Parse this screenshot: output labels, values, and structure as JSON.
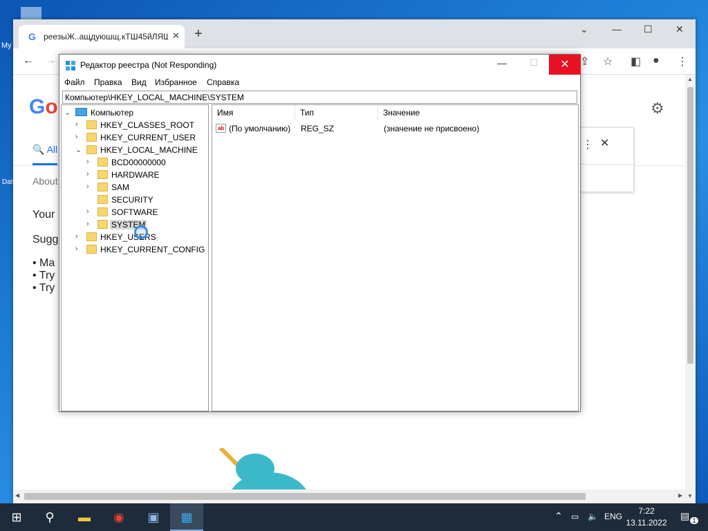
{
  "desktop": {
    "icon1_label": "My",
    "icon2_label": "Dat"
  },
  "chrome": {
    "tab_title": "реезыЖ..ащдуюшщ.кТШ45йЛЯШ",
    "tab_favicon": "G",
    "close_tab": "✕",
    "new_tab": "+",
    "minimize": "⌄",
    "restore": "—",
    "maximize": "☐",
    "close": "✕",
    "page": {
      "logo": "Go",
      "tab_all": "All",
      "about": "About",
      "line1": "Your",
      "line2": "Sugg",
      "bullets": [
        "Ma",
        "Try",
        "Try"
      ]
    }
  },
  "regedit": {
    "title": "Редактор реестра (Not Responding)",
    "close_label": "✕",
    "minimize_label": "—",
    "maximize_label": "☐",
    "menu": {
      "file": "Файл",
      "edit": "Правка",
      "view": "Вид",
      "favorites": "Избранное",
      "help": "Справка"
    },
    "address": "Компьютер\\HKEY_LOCAL_MACHINE\\SYSTEM",
    "tree": {
      "root": "Компьютер",
      "classes_root": "HKEY_CLASSES_ROOT",
      "current_user": "HKEY_CURRENT_USER",
      "local_machine": "HKEY_LOCAL_MACHINE",
      "bcd": "BCD00000000",
      "hardware": "HARDWARE",
      "sam": "SAM",
      "security": "SECURITY",
      "software": "SOFTWARE",
      "system": "SYSTEM",
      "users": "HKEY_USERS",
      "current_config": "HKEY_CURRENT_CONFIG"
    },
    "columns": {
      "name": "Имя",
      "type": "Тип",
      "value": "Значение"
    },
    "rows": [
      {
        "name": "(По умолчанию)",
        "type": "REG_SZ",
        "value": "(значение не присвоено)"
      }
    ]
  },
  "taskbar": {
    "language": "ENG",
    "time": "7:22",
    "date": "13.11.2022",
    "notification_count": "1"
  },
  "colors": {
    "close_red": "#e81123",
    "selection_grey": "#d9d9d9",
    "accent_blue": "#1a73e8"
  }
}
